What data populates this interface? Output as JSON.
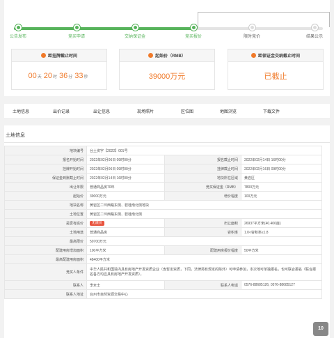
{
  "steps": [
    {
      "label": "公告发布",
      "done": true
    },
    {
      "label": "竞买申请",
      "done": true
    },
    {
      "label": "交纳保证金",
      "done": true
    },
    {
      "label": "竞买报价",
      "done": true
    },
    {
      "label": "限时竞价",
      "done": false
    },
    {
      "label": "结果公示",
      "done": false
    }
  ],
  "countdown": {
    "title": "距挂牌截止时间",
    "days": "00",
    "days_unit": "天",
    "hours": "20",
    "hours_unit": "时",
    "minutes": "36",
    "minutes_unit": "分",
    "seconds": "33",
    "seconds_unit": "秒"
  },
  "start_price": {
    "title": "起始价（RMB）",
    "value": "39000万元"
  },
  "deposit": {
    "title": "距保证金交纳截止时间",
    "value": "已截止"
  },
  "tabs": [
    "土地信息",
    "出价记录",
    "出让信息",
    "现场照片",
    "区位图",
    "地图浏览",
    "下载文件"
  ],
  "land_title": "土地信息",
  "rows": {
    "r1": {
      "k1": "地块编号",
      "v1": "台土资字【2022】001号"
    },
    "r2": {
      "k1": "报名开始时间",
      "v1": "2022年02月06日 09时00分",
      "k2": "报名截止时间",
      "v2": "2022年02月14日 16时00分"
    },
    "r3": {
      "k1": "挂牌开始时间",
      "v1": "2022年02月06日 09时00分",
      "k2": "挂牌截止时间",
      "v2": "2022年02月16日 09时00分"
    },
    "r4": {
      "k1": "保证金到账截止时间",
      "v1": "2022年02月14日 16时00分",
      "k2": "地块所在区域",
      "v2": "黄岩区"
    },
    "r5": {
      "k1": "出让年限",
      "v1": "普通商品房70年",
      "k2": "竞买保证金（RMB）",
      "v2": "7800万元"
    },
    "r6": {
      "k1": "起始价",
      "v1": "39000万元",
      "k2": "增价幅度",
      "v2": "100万元"
    },
    "r7": {
      "k1": "地块名称",
      "v1": "黄岩区二环西路东侧、碧桂南北侧地块"
    },
    "r8": {
      "k1": "土地位置",
      "v1": "黄岩区二环西路东侧、碧桂南北侧"
    },
    "r9": {
      "k1": "是否有底价",
      "v1": "无底价",
      "k2": "出让面积",
      "v2": "26937平方米(40.406亩)"
    },
    "r10": {
      "k1": "土地用途",
      "v1": "普通商品房",
      "k2": "容积率",
      "v2": "1.0<容积率≤1.8"
    },
    "r11": {
      "k1": "最高限价",
      "v1": "50700万元"
    },
    "r12": {
      "k1": "配建用房增加面积",
      "v1": "100平方米",
      "k2": "配建用房报价幅度",
      "v2": "50平方米"
    },
    "r13": {
      "k1": "最高配建用房面积",
      "v1": "48400平方米"
    },
    "r14": {
      "k1": "竞买人条件",
      "v1": "中华人民共和国境内具有房地产开发资质企业（含暂定资质，下同，法律另有规定的除外）可申请参加，本次地可单独报名，也可联合报名（联合报名各方均应具有房地产开发资质）。"
    },
    "r15": {
      "k1": "联系人",
      "v1": "李女士",
      "k2": "联系人电话",
      "v2": "0576-88685126, 0576-88685127"
    },
    "r16": {
      "k1": "联系人地址",
      "v1": "台州市自然资源交易中心"
    }
  },
  "badge": "10"
}
